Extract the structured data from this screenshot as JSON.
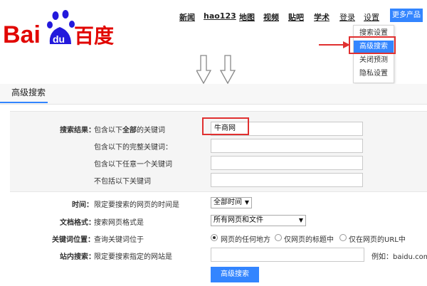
{
  "logo": {
    "text_left": "Bai",
    "text_paw": "du",
    "text_right": "百度"
  },
  "topnav": [
    {
      "label": "新闻"
    },
    {
      "label": "hao123"
    },
    {
      "label": "地图"
    },
    {
      "label": "视频"
    },
    {
      "label": "贴吧"
    },
    {
      "label": "学术"
    },
    {
      "label": "登录"
    },
    {
      "label": "设置"
    }
  ],
  "more_products": "更多产品",
  "settings_menu": [
    "搜索设置",
    "高级搜索",
    "关闭预测",
    "隐私设置"
  ],
  "tab": "高级搜索",
  "form": {
    "search_result_label": "搜索结果：",
    "contain_all_prefix": "包含以下",
    "contain_all_bold": "全部",
    "contain_all_suffix": "的关键词",
    "contain_all_value": "牛商网",
    "exact_label": "包含以下的完整关键词：",
    "any_label": "包含以下任意一个关键词",
    "exclude_label": "不包括以下关键词",
    "time_label": "时间：",
    "time_desc": "限定要搜索的网页的时间是",
    "time_value": "全部时间",
    "format_label": "文档格式：",
    "format_desc": "搜索网页格式是",
    "format_value": "所有网页和文件",
    "kwpos_label": "关键词位置：",
    "kwpos_desc": "查询关键词位于",
    "kwpos_options": [
      "网页的任何地方",
      "仅网页的标题中",
      "仅在网页的URL中"
    ],
    "site_label": "站内搜索：",
    "site_desc": "限定要搜索指定的网站是",
    "site_example": "例如：baidu.com",
    "submit": "高级搜索"
  },
  "colors": {
    "accent": "#3385ff",
    "highlight": "#e03030",
    "logo_red": "#e10602",
    "logo_blue": "#2319dc"
  }
}
